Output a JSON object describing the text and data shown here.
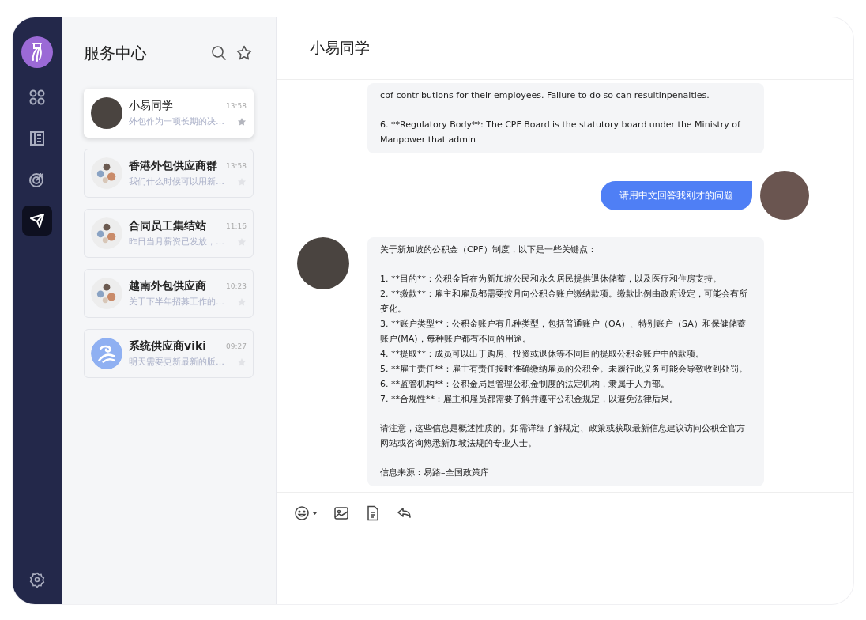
{
  "nav": {
    "items": [
      {
        "kind": "apps",
        "selected": false
      },
      {
        "kind": "report",
        "selected": false
      },
      {
        "kind": "target",
        "selected": false
      },
      {
        "kind": "send",
        "selected": true
      }
    ]
  },
  "list": {
    "title": "服务中心",
    "conversations": [
      {
        "name": "小易同学",
        "preview": "外包作为一项长期的决…",
        "time": "13:58",
        "avatar": {
          "kind": "person"
        },
        "selected": true,
        "starred": true
      },
      {
        "name": "香港外包供应商群",
        "preview": "我们什么时候可以用新…",
        "time": "13:58",
        "avatar": {
          "kind": "group"
        },
        "selected": false,
        "starred": false
      },
      {
        "name": "合同员工集结站",
        "preview": "昨日当月薪资已发放，…",
        "time": "11:16",
        "avatar": {
          "kind": "group"
        },
        "selected": false,
        "starred": false
      },
      {
        "name": "越南外包供应商",
        "preview": "关于下半年招募工作的…",
        "time": "10:23",
        "avatar": {
          "kind": "group"
        },
        "selected": false,
        "starred": false
      },
      {
        "name": "系统供应商viki",
        "preview": "明天需要更新最新的版…",
        "time": "09:27",
        "avatar": {
          "kind": "logo"
        },
        "selected": false,
        "starred": false
      }
    ]
  },
  "chat": {
    "title": "小易同学",
    "messages": [
      {
        "kind": "bot_continued",
        "paragraphs": [
          "cpf contributions for their employees. Failure to do so can resultinpenalties.",
          "6. **Regulatory Body**: The CPF Board is the statutory board under the Ministry of Manpower that admin"
        ]
      },
      {
        "kind": "user",
        "paragraphs": [
          "请用中文回答我刚才的问题"
        ]
      },
      {
        "kind": "bot",
        "paragraphs": [
          "关于新加坡的公积金（CPF）制度，以下是一些关键点：",
          "1. **目的**：公积金旨在为新加坡公民和永久居民提供退休储蓄，以及医疗和住房支持。\n2. **缴款**：雇主和雇员都需要按月向公积金账户缴纳款项。缴款比例由政府设定，可能会有所变化。\n3. **账户类型**：公积金账户有几种类型，包括普通账户（OA）、特别账户（SA）和保健储蓄账户(MA)，每种账户都有不同的用途。\n4. **提取**：成员可以出于购房、投资或退休等不同目的提取公积金账户中的款项。\n5. **雇主责任**：雇主有责任按时准确缴纳雇员的公积金。未履行此义务可能会导致收到处罚。\n6. **监管机构**：公积金局是管理公积金制度的法定机构，隶属于人力部。\n7. **合规性**：雇主和雇员都需要了解并遵守公积金规定，以避免法律后果。",
          "请注意，这些信息是概述性质的。如需详细了解规定、政策或获取最新信息建议访问公积金官方网站或咨询熟悉新加坡法规的专业人士。",
          "信息来源：易路–全国政策库"
        ]
      }
    ],
    "toolbar": [
      {
        "kind": "emoji"
      },
      {
        "kind": "image"
      },
      {
        "kind": "document"
      },
      {
        "kind": "reply"
      }
    ]
  }
}
